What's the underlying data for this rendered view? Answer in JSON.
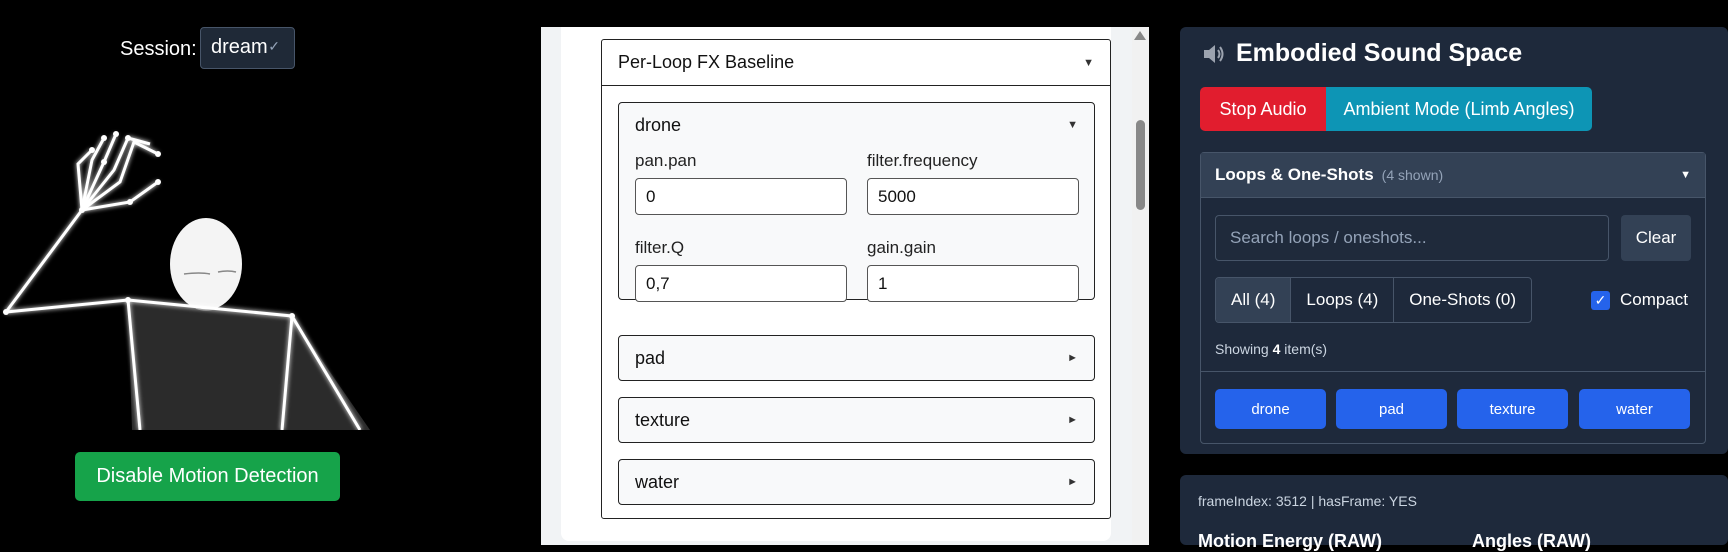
{
  "session": {
    "label": "Session:",
    "value": "dream"
  },
  "camera": {
    "description_icon": "pose-skeleton"
  },
  "motion_button": "Disable Motion Detection",
  "fx": {
    "title": "Per-Loop FX Baseline",
    "loops": [
      {
        "name": "drone",
        "expanded": true,
        "fields": [
          {
            "label": "pan.pan",
            "value": "0"
          },
          {
            "label": "filter.frequency",
            "value": "5000"
          },
          {
            "label": "filter.Q",
            "value": "0,7"
          },
          {
            "label": "gain.gain",
            "value": "1"
          }
        ]
      },
      {
        "name": "pad",
        "expanded": false
      },
      {
        "name": "texture",
        "expanded": false
      },
      {
        "name": "water",
        "expanded": false
      }
    ]
  },
  "app": {
    "title": "Embodied Sound Space",
    "stop_button": "Stop Audio",
    "ambient_button": "Ambient Mode (Limb Angles)",
    "colors": {
      "stop": "#e11d2e",
      "ambient": "#0d95b5",
      "accent": "#2563eb"
    }
  },
  "loops_panel": {
    "title": "Loops & One-Shots",
    "count": "(4 shown)",
    "search_placeholder": "Search loops / oneshots...",
    "clear_label": "Clear",
    "filters": [
      "All (4)",
      "Loops (4)",
      "One-Shots (0)"
    ],
    "active_filter": "All (4)",
    "compact_label": "Compact",
    "compact_checked": true,
    "showing_prefix": "Showing",
    "showing_count": "4",
    "showing_suffix": "item(s)",
    "items": [
      "drone",
      "pad",
      "texture",
      "water"
    ]
  },
  "debug": {
    "frame_info": "frameIndex: 3512 | hasFrame: YES",
    "motion_energy": "Motion Energy (RAW)",
    "angles": "Angles (RAW)"
  }
}
